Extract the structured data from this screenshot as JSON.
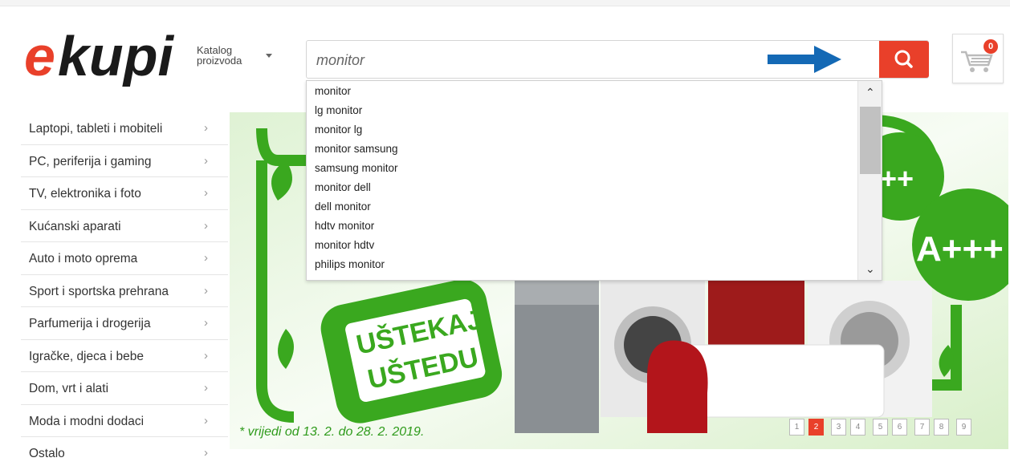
{
  "header": {
    "logo_text": "ekupi",
    "catalog_label": "Katalog proizvoda",
    "cart_count": "0"
  },
  "search": {
    "value": "monitor",
    "suggestions": [
      "monitor",
      "lg monitor",
      "monitor lg",
      "monitor samsung",
      "samsung monitor",
      "monitor dell",
      "dell monitor",
      "hdtv monitor",
      "monitor hdtv",
      "philips monitor"
    ]
  },
  "sidebar": {
    "items": [
      "Laptopi, tableti i mobiteli",
      "PC, periferija i gaming",
      "TV, elektronika i foto",
      "Kućanski aparati",
      "Auto i moto oprema",
      "Sport i sportska prehrana",
      "Parfumerija i drogerija",
      "Igračke, djeca i bebe",
      "Dom, vrt i alati",
      "Moda i modni dodaci",
      "Ostalo"
    ]
  },
  "banner": {
    "slogan_line1": "UŠTEKAJ",
    "slogan_line2": "UŠTEDU",
    "energy_label_1": "++",
    "energy_label_2": "A+++",
    "validity": "* vrijedi od 13. 2. do 28. 2. 2019."
  },
  "pagination": {
    "pages": [
      "1",
      "2",
      "3",
      "4",
      "5",
      "6",
      "7",
      "8",
      "9"
    ],
    "active": "2"
  },
  "colors": {
    "brand_red": "#e9402a",
    "banner_green": "#2f9b1c",
    "arrow_blue": "#1469b5"
  },
  "icons": {
    "search": "search-icon",
    "cart": "cart-icon",
    "caret": "caret-down-icon",
    "arrow": "arrow-right-icon"
  }
}
